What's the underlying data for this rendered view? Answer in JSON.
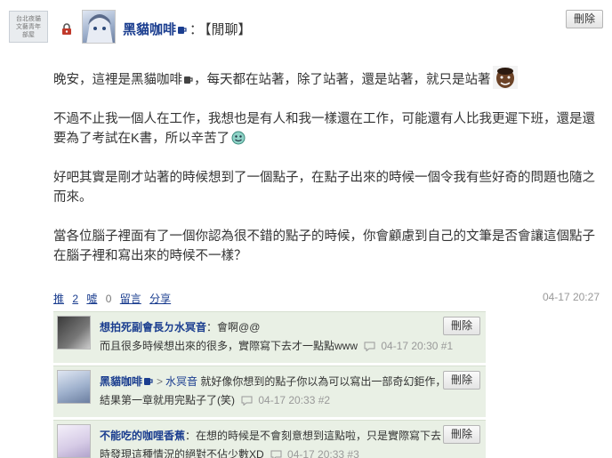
{
  "header": {
    "group_thumb_text": "台北夜貓 文藝青年 部屋",
    "author": "黑貓咖啡",
    "separator": "：",
    "category": "【閒聊】",
    "delete_label": "刪除"
  },
  "post": {
    "paragraphs": [
      "晚安，這裡是黑貓咖啡🍵，每天都在站著，除了站著，還是站著，就只是站著",
      "不過不止我一個人在工作，我想也是有人和我一樣還在工作，可能還有人比我更遲下班，還是還要為了考試在K書，所以辛苦了",
      "好吧其實是剛才站著的時候想到了一個點子，在點子出來的時候一個令我有些好奇的問題也隨之而來。",
      "當各位腦子裡面有了一個你認為很不錯的點子的時候，你會顧慮到自己的文筆是否會讓這個點子在腦子裡和寫出來的時候不一樣？"
    ],
    "p1_main": "晚安，這裡是黑貓咖啡",
    "p1_rest": "，每天都在站著，除了站著，還是站著，就只是站著",
    "p2": "不過不止我一個人在工作，我想也是有人和我一樣還在工作，可能還有人比我更遲下班，還是還要為了考試在K書，所以辛苦了",
    "p3": "好吧其實是剛才站著的時候想到了一個點子，在點子出來的時候一個令我有些好奇的問題也隨之而來。",
    "p4": "當各位腦子裡面有了一個你認為很不錯的點子的時候，你會顧慮到自己的文筆是否會讓這個點子在腦子裡和寫出來的時候不一樣？"
  },
  "actions": {
    "push_label": "推",
    "push_count": "2",
    "boo_label": "噓",
    "boo_count": "0",
    "comment_label": "留言",
    "share_label": "分享",
    "timestamp": "04-17 20:27"
  },
  "comments": [
    {
      "author": "想拍死副會長ㄉ水冥音",
      "reply_to": "",
      "line1": "：會啊@@",
      "line2": "而且很多時候想出來的很多，實際寫下去才一點點www",
      "time": "04-17 20:30",
      "floor": "#1",
      "delete_label": "刪除"
    },
    {
      "author": "黑貓咖啡",
      "reply_to": "水冥音",
      "line1": " 就好像你想到的點子你以為可以寫出一部奇幻鉅作，",
      "line2": "結果第一章就用完點子了(笑)",
      "time": "04-17 20:33",
      "floor": "#2",
      "delete_label": "刪除"
    },
    {
      "author": "不能吃的咖哩香蕉",
      "reply_to": "",
      "line1": "：在想的時候是不會刻意想到這點啦，只是實際寫下去",
      "line2": "時發現這種情況的絕對不佔少數XD",
      "time": "04-17 20:33",
      "floor": "#3",
      "delete_label": "刪除"
    }
  ],
  "colors": {
    "link_blue": "#1a3d8f",
    "comment_bg": "#e9f0e5",
    "meta_gray": "#999999"
  },
  "icons": [
    "lock-icon",
    "coffee-mug-icon",
    "face-emoji-icon",
    "smile-emoji-icon",
    "comment-bubble-icon"
  ]
}
